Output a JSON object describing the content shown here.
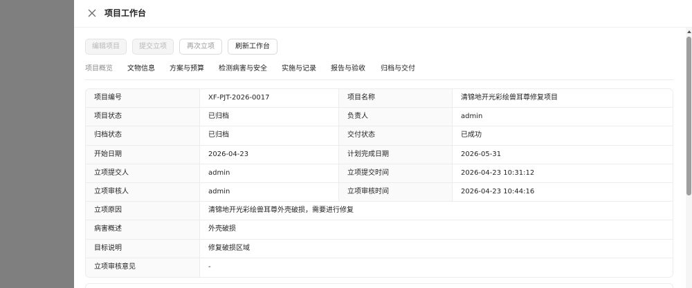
{
  "header": {
    "title": "项目工作台",
    "close_icon": "close-icon"
  },
  "toolbar": {
    "edit_label": "编辑项目",
    "submit_label": "提交立项",
    "resubmit_label": "再次立项",
    "refresh_label": "刷新工作台"
  },
  "tabs": [
    {
      "label": "项目概览",
      "active": true
    },
    {
      "label": "文物信息",
      "active": false
    },
    {
      "label": "方案与预算",
      "active": false
    },
    {
      "label": "检测病害与安全",
      "active": false
    },
    {
      "label": "实施与记录",
      "active": false
    },
    {
      "label": "报告与验收",
      "active": false
    },
    {
      "label": "归档与交付",
      "active": false
    }
  ],
  "overview": {
    "pairs": [
      {
        "label1": "项目编号",
        "value1": "XF-PJT-2026-0017",
        "label2": "项目名称",
        "value2": "清锦地开光彩绘兽耳尊修复项目"
      },
      {
        "label1": "项目状态",
        "value1": "已归档",
        "label2": "负责人",
        "value2": "admin"
      },
      {
        "label1": "归档状态",
        "value1": "已归档",
        "label2": "交付状态",
        "value2": "已成功"
      },
      {
        "label1": "开始日期",
        "value1": "2026-04-23",
        "label2": "计划完成日期",
        "value2": "2026-05-31"
      },
      {
        "label1": "立项提交人",
        "value1": "admin",
        "label2": "立项提交时间",
        "value2": "2026-04-23 10:31:12"
      },
      {
        "label1": "立项审核人",
        "value1": "admin",
        "label2": "立项审核时间",
        "value2": "2026-04-23 10:44:16"
      }
    ],
    "wide": [
      {
        "label": "立项原因",
        "value": "清锦地开光彩绘兽耳尊外壳破损，需要进行修复"
      },
      {
        "label": "病害概述",
        "value": "外壳破损"
      },
      {
        "label": "目标说明",
        "value": "修复破损区域"
      },
      {
        "label": "立项审核意见",
        "value": "-"
      }
    ]
  },
  "colors": {
    "backdrop": "#7f7f7f",
    "label_bg": "#fafafa",
    "border": "#ececec",
    "disabled_text": "#b9b9b9"
  }
}
